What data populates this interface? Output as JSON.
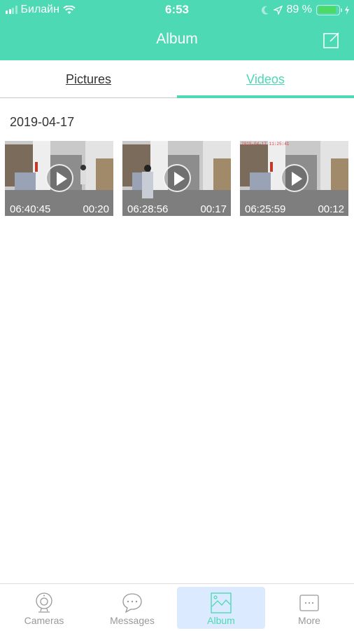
{
  "status_bar": {
    "carrier": "Билайн",
    "time": "6:53",
    "battery_percent": "89 %",
    "battery_level": 0.89
  },
  "header": {
    "title": "Album",
    "edit_icon": "edit-icon"
  },
  "tabs": [
    {
      "label": "Pictures",
      "active": false
    },
    {
      "label": "Videos",
      "active": true
    }
  ],
  "section": {
    "date": "2019-04-17"
  },
  "videos": [
    {
      "time": "06:40:45",
      "duration": "00:20",
      "stamp": ""
    },
    {
      "time": "06:28:56",
      "duration": "00:17",
      "stamp": ""
    },
    {
      "time": "06:25:59",
      "duration": "00:12",
      "stamp": "2019-04-17 11:25:41"
    }
  ],
  "tabbar": {
    "items": [
      {
        "label": "Cameras",
        "icon": "camera-icon",
        "active": false
      },
      {
        "label": "Messages",
        "icon": "message-icon",
        "active": false
      },
      {
        "label": "Album",
        "icon": "image-icon",
        "active": true
      },
      {
        "label": "More",
        "icon": "more-icon",
        "active": false
      }
    ]
  },
  "colors": {
    "accent": "#4cd9b3",
    "active_tab_bg": "#dbeafe",
    "inactive": "#999999"
  }
}
